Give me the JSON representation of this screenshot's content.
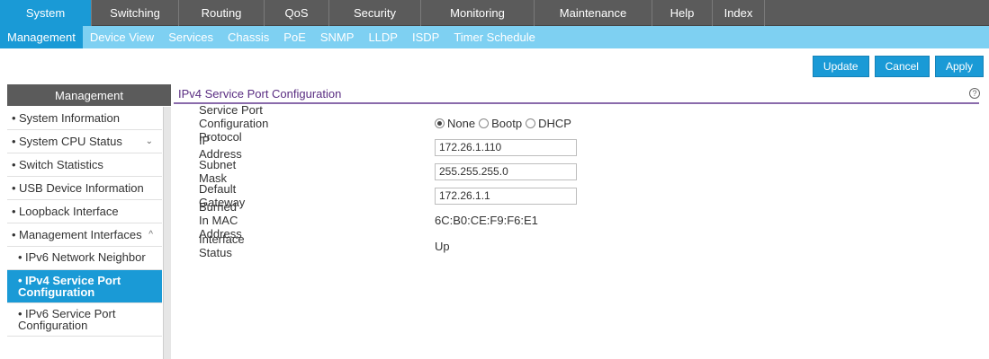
{
  "topnav": [
    {
      "label": "System",
      "active": true
    },
    {
      "label": "Switching"
    },
    {
      "label": "Routing"
    },
    {
      "label": "QoS"
    },
    {
      "label": "Security"
    },
    {
      "label": "Monitoring"
    },
    {
      "label": "Maintenance"
    },
    {
      "label": "Help"
    },
    {
      "label": "Index"
    }
  ],
  "subnav": [
    {
      "label": "Management",
      "active": true
    },
    {
      "label": "Device View"
    },
    {
      "label": "Services"
    },
    {
      "label": "Chassis"
    },
    {
      "label": "PoE"
    },
    {
      "label": "SNMP"
    },
    {
      "label": "LLDP"
    },
    {
      "label": "ISDP"
    },
    {
      "label": "Timer Schedule"
    }
  ],
  "actions": {
    "update": "Update",
    "cancel": "Cancel",
    "apply": "Apply"
  },
  "sidebar": {
    "header": "Management",
    "items": [
      {
        "label": "System Information"
      },
      {
        "label": "System CPU Status",
        "chevron": "⌄"
      },
      {
        "label": "Switch Statistics"
      },
      {
        "label": "USB Device Information"
      },
      {
        "label": "Loopback Interface"
      },
      {
        "label": "Management Interfaces",
        "chevron": "^"
      },
      {
        "label": "IPv6 Network Neighbor",
        "sub": true
      },
      {
        "label": "IPv4 Service Port Configuration",
        "sub": true,
        "selected": true
      },
      {
        "label": "IPv6 Service Port Configuration",
        "sub": true
      }
    ]
  },
  "content": {
    "title": "IPv4 Service Port Configuration",
    "fields": {
      "protocol_label": "Service Port Configuration Protocol",
      "protocol_options": [
        "None",
        "Bootp",
        "DHCP"
      ],
      "protocol_selected": "None",
      "ip_label": "IP Address",
      "ip_value": "172.26.1.110",
      "mask_label": "Subnet Mask",
      "mask_value": "255.255.255.0",
      "gateway_label": "Default Gateway",
      "gateway_value": "172.26.1.1",
      "mac_label": "Burned In MAC Address",
      "mac_value": "6C:B0:CE:F9:F6:E1",
      "status_label": "Interface Status",
      "status_value": "Up"
    }
  },
  "colors": {
    "accent": "#1a9ad6",
    "subnav": "#7ed0f2",
    "nav": "#5b5b5b",
    "title": "#5a2d82"
  }
}
